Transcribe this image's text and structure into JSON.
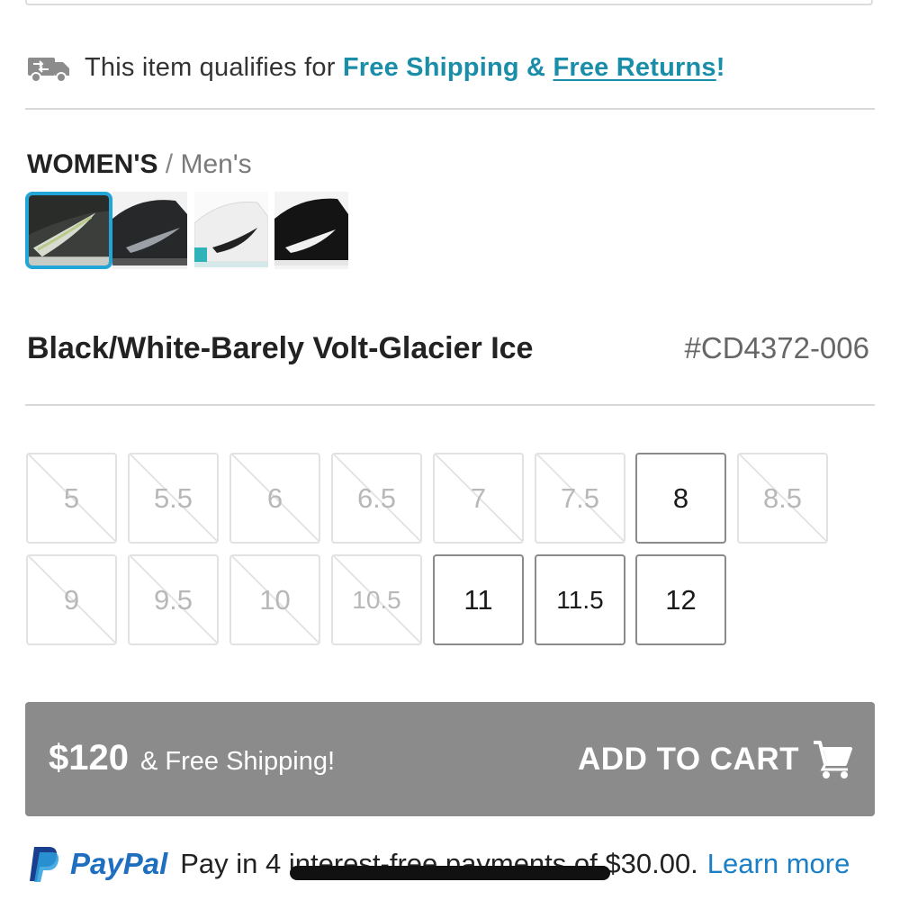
{
  "shipping": {
    "icon": "truck-arrows-icon",
    "prefix": "This item qualifies for ",
    "highlight": "Free Shipping & ",
    "link": "Free Returns",
    "suffix": "!"
  },
  "gender": {
    "selected": "WOMEN'S",
    "separator": " / ",
    "other": "Men's"
  },
  "swatches": [
    {
      "name": "black-white-volt",
      "selected": true
    },
    {
      "name": "black-grey",
      "selected": false
    },
    {
      "name": "white-teal",
      "selected": false
    },
    {
      "name": "black-white",
      "selected": false
    }
  ],
  "product": {
    "color_name": "Black/White-Barely Volt-Glacier Ice",
    "style_code": "#CD4372-006"
  },
  "sizes": [
    {
      "label": "5",
      "available": false
    },
    {
      "label": "5.5",
      "available": false
    },
    {
      "label": "6",
      "available": false
    },
    {
      "label": "6.5",
      "available": false
    },
    {
      "label": "7",
      "available": false
    },
    {
      "label": "7.5",
      "available": false
    },
    {
      "label": "8",
      "available": true
    },
    {
      "label": "8.5",
      "available": false
    },
    {
      "label": "9",
      "available": false
    },
    {
      "label": "9.5",
      "available": false
    },
    {
      "label": "10",
      "available": false
    },
    {
      "label": "10.5",
      "available": false
    },
    {
      "label": "11",
      "available": true
    },
    {
      "label": "11.5",
      "available": true
    },
    {
      "label": "12",
      "available": true
    }
  ],
  "cart": {
    "price": "$120",
    "price_note": "& Free Shipping!",
    "label": "ADD TO CART",
    "icon": "cart-icon"
  },
  "paypal": {
    "brand": "PayPal",
    "text": "Pay in 4 interest-free payments of $30.00.",
    "link": "Learn more"
  },
  "colors": {
    "accent": "#1a8ea8",
    "selected_border": "#22a6d8",
    "cart_bg": "#8b8b8b",
    "paypal_blue": "#1f6fc1"
  }
}
